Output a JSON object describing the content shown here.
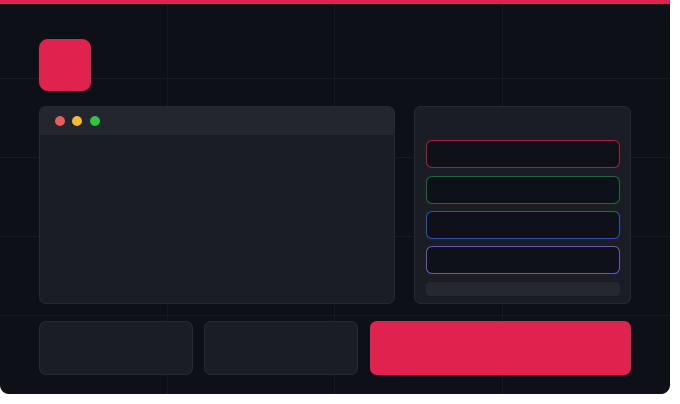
{
  "colors": {
    "background": "#0d1017",
    "accent": "#e0234e",
    "panel": "#1a1d24",
    "panel_border": "#252933",
    "titlebar": "#23262e",
    "traffic_close": "#ed5c5c",
    "traffic_minimize": "#f5bb2c",
    "traffic_maximize": "#2bc840",
    "option_red": "#9b2438",
    "option_green": "#1c6a3c",
    "option_blue": "#2255b6",
    "option_purple": "#6a54b6",
    "footer_bar": "#25282f"
  },
  "icons": {
    "logo": "rounded-square-logo",
    "window_controls": [
      "close-dot",
      "minimize-dot",
      "maximize-dot"
    ]
  },
  "editor_window": {
    "title": ""
  },
  "options_panel": {
    "slots": [
      {
        "label": "",
        "color": "#9b2438"
      },
      {
        "label": "",
        "color": "#1c6a3c"
      },
      {
        "label": "",
        "color": "#2255b6"
      },
      {
        "label": "",
        "color": "#6a54b6"
      }
    ]
  },
  "bottom_bar": {
    "card_1_label": "",
    "card_2_label": "",
    "primary_label": ""
  }
}
